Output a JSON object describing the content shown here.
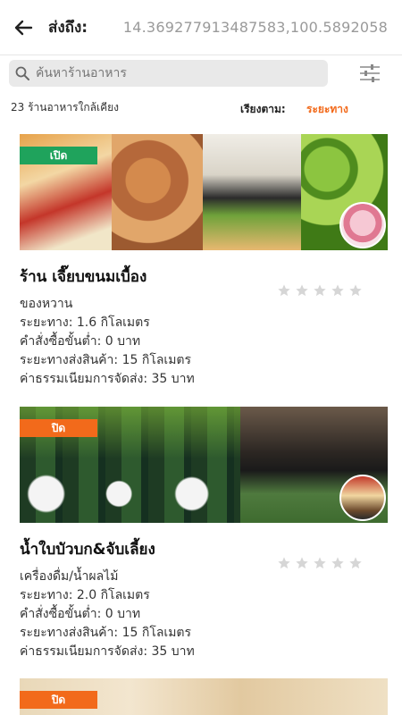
{
  "header": {
    "deliver_label": "ส่งถึง:",
    "coords": "14.369277913487583,100.5892058"
  },
  "search": {
    "placeholder": "ค้นหาร้านอาหาร"
  },
  "meta": {
    "count_text": "23 ร้านอาหารใกล้เคียง",
    "sort_label": "เรียงตาม:",
    "sort_value": "ระยะทาง"
  },
  "colors": {
    "open": "#1fa35c",
    "closed": "#f26a1b",
    "star": "#d6d6d6",
    "accent": "#f26a1b"
  },
  "shops": [
    {
      "status": "เปิด",
      "name": "ร้าน เจี๊ยบขนมเบื้อง",
      "category": "ของหวาน",
      "distance": "ระยะทาง: 1.6 กิโลเมตร",
      "min_order": "คำสั่งซื้อขั้นต่ำ: 0 บาท",
      "delivery_distance": "ระยะทางส่งสินค้า: 15 กิโลเมตร",
      "delivery_fee": "ค่าธรรมเนียมการจัดส่ง: 35 บาท",
      "rating": 0
    },
    {
      "status": "ปิด",
      "name": "น้ำใบบัวบก&จับเลี้ยง",
      "category": "เครื่องดื่ม/น้ำผลไม้",
      "distance": "ระยะทาง: 2.0 กิโลเมตร",
      "min_order": "คำสั่งซื้อขั้นต่ำ: 0 บาท",
      "delivery_distance": "ระยะทางส่งสินค้า: 15 กิโลเมตร",
      "delivery_fee": "ค่าธรรมเนียมการจัดส่ง: 35 บาท",
      "rating": 0
    },
    {
      "status": "ปิด"
    }
  ]
}
